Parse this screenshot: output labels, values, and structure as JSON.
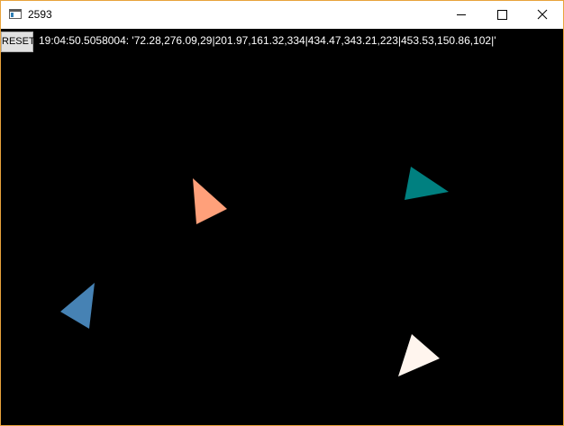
{
  "window": {
    "title": "2593",
    "border_color": "#e8a33c",
    "buttons": {
      "minimize": "minimize-icon",
      "maximize": "maximize-icon",
      "close": "close-icon"
    }
  },
  "toolbar": {
    "reset_label": "RESET"
  },
  "status": {
    "text": "19:04:50.5058004: '72.28,276.09,29|201.97,161.32,334|434.47,343.21,223|453.53,150.86,102|'"
  },
  "scene": {
    "background": "#000000",
    "triangles": [
      {
        "name": "blue-triangle",
        "color": "#4682b4"
      },
      {
        "name": "salmon-triangle",
        "color": "#ffa07a"
      },
      {
        "name": "white-triangle",
        "color": "#fff5ee"
      },
      {
        "name": "teal-triangle",
        "color": "#008080"
      }
    ]
  }
}
